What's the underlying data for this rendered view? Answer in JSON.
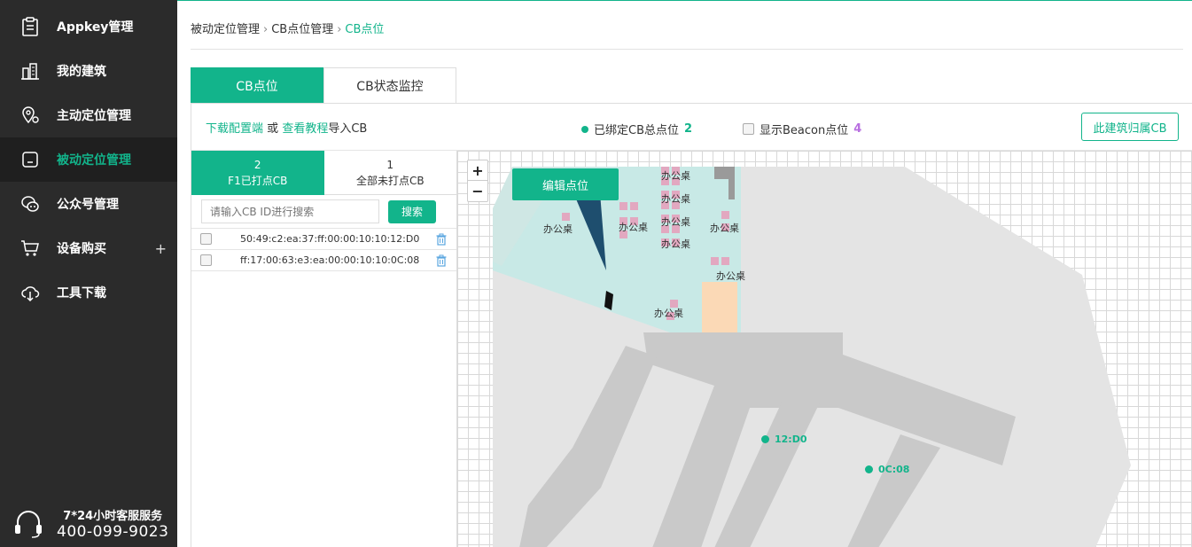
{
  "sidebar": {
    "items": [
      {
        "label": "Appkey管理",
        "icon": "clipboard-icon"
      },
      {
        "label": "我的建筑",
        "icon": "building-icon"
      },
      {
        "label": "主动定位管理",
        "icon": "location-pin-icon"
      },
      {
        "label": "被动定位管理",
        "icon": "device-icon"
      },
      {
        "label": "公众号管理",
        "icon": "wechat-icon"
      },
      {
        "label": "设备购买",
        "icon": "cart-icon",
        "extra": "+"
      },
      {
        "label": "工具下载",
        "icon": "cloud-download-icon"
      }
    ],
    "active_index": 3,
    "service_title": "7*24小时客服服务",
    "service_phone": "400-099-9023"
  },
  "breadcrumb": {
    "items": [
      "被动定位管理",
      "CB点位管理",
      "CB点位"
    ],
    "separator": "›"
  },
  "tabs": {
    "items": [
      "CB点位",
      "CB状态监控"
    ],
    "active_index": 0
  },
  "toolbar": {
    "link_download": "下载配置端",
    "or_text": "或",
    "link_tutorial": "查看教程",
    "import_text": "导入CB",
    "bound_label": "已绑定CB总点位",
    "bound_count": "2",
    "beacon_label": "显示Beacon点位",
    "beacon_count": "4",
    "building_cb_button": "此建筑归属CB"
  },
  "subtabs": [
    {
      "count": "2",
      "label": "F1已打点CB"
    },
    {
      "count": "1",
      "label": "全部未打点CB"
    }
  ],
  "search": {
    "placeholder": "请输入CB ID进行搜索",
    "button": "搜索"
  },
  "cb_list": [
    {
      "id": "50:49:c2:ea:37:ff:00:00:10:10:12:D0"
    },
    {
      "id": "ff:17:00:63:e3:ea:00:00:10:10:0C:08"
    }
  ],
  "map": {
    "zoom_in": "+",
    "zoom_out": "−",
    "edit_button": "编辑点位",
    "desk_label": "办公桌",
    "points": [
      {
        "label": "12:D0"
      },
      {
        "label": "0C:08"
      }
    ]
  },
  "colors": {
    "accent": "#12b48b",
    "sidebar_bg": "#2b2b2b",
    "beacon_count": "#b86fe0"
  }
}
